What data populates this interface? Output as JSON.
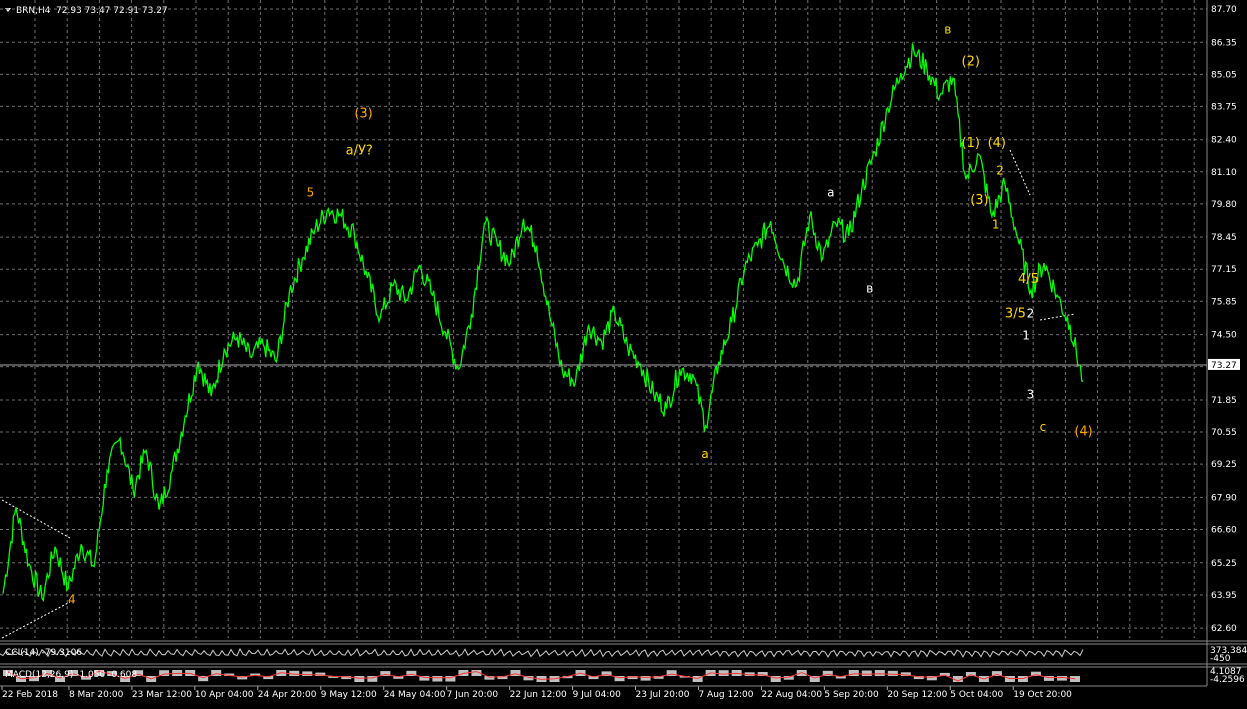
{
  "header": {
    "symbol": "BRN,H4",
    "ohlc": "72.93 73.47 72.91 73.27"
  },
  "current_price_label": "73.27",
  "colors": {
    "background": "#000000",
    "grid": "#6f6f6f",
    "price_line": "#00ff00",
    "wave_label_orange": "#ffa500",
    "wave_label_yellow": "#ffd700",
    "wave_label_white": "#ffffff"
  },
  "indicators": {
    "cci": {
      "label": "CCI(14) -79.3106",
      "scale_top": "373.3845",
      "scale_bottom": "-450"
    },
    "macd": {
      "label": "MACD(12,26,9) -1.050 -0.608",
      "scale_top": "4.1087",
      "scale_bottom": "-4.2596"
    }
  },
  "chart_data": {
    "type": "line",
    "title": "",
    "xlabel": "",
    "ylabel": "",
    "ylim": [
      62.2,
      87.7
    ],
    "grid": true,
    "y_ticks": [
      "87.70",
      "86.35",
      "85.05",
      "83.75",
      "82.40",
      "81.10",
      "79.80",
      "78.45",
      "77.15",
      "75.85",
      "74.50",
      "73.20",
      "71.85",
      "70.55",
      "69.25",
      "67.90",
      "66.60",
      "65.25",
      "63.95",
      "62.60"
    ],
    "x_ticks": [
      "22 Feb 2018",
      "8 Mar 20:00",
      "23 Mar 12:00",
      "10 Apr 04:00",
      "24 Apr 20:00",
      "9 May 12:00",
      "24 May 04:00",
      "7 Jun 20:00",
      "22 Jun 12:00",
      "9 Jul 04:00",
      "23 Jul 20:00",
      "7 Aug 12:00",
      "22 Aug 04:00",
      "5 Sep 20:00",
      "20 Sep 12:00",
      "5 Oct 04:00",
      "19 Oct 20:00"
    ],
    "x_range": [
      "22 Feb 2018",
      "29 Oct 2018"
    ],
    "series": [
      {
        "dates": [
          "22 Feb",
          "25 Feb",
          "28 Feb",
          "3 Mar",
          "6 Mar",
          "9 Mar",
          "12 Mar",
          "15 Mar",
          "18 Mar",
          "21 Mar",
          "24 Mar",
          "27 Mar",
          "30 Mar",
          "2 Apr",
          "5 Apr",
          "8 Apr",
          "11 Apr",
          "14 Apr",
          "17 Apr",
          "20 Apr",
          "23 Apr",
          "26 Apr",
          "29 Apr",
          "2 May",
          "5 May",
          "8 May",
          "11 May",
          "14 May",
          "17 May",
          "20 May",
          "23 May",
          "26 May",
          "29 May",
          "1 Jun",
          "4 Jun",
          "7 Jun",
          "10 Jun",
          "13 Jun",
          "16 Jun",
          "19 Jun",
          "22 Jun",
          "25 Jun",
          "28 Jun",
          "1 Jul",
          "4 Jul",
          "7 Jul",
          "10 Jul",
          "13 Jul",
          "16 Jul",
          "19 Jul",
          "22 Jul",
          "25 Jul",
          "28 Jul",
          "31 Jul",
          "3 Aug",
          "6 Aug",
          "9 Aug",
          "12 Aug",
          "15 Aug",
          "18 Aug",
          "21 Aug",
          "24 Aug",
          "27 Aug",
          "30 Aug",
          "2 Sep",
          "5 Sep",
          "8 Sep",
          "11 Sep",
          "14 Sep",
          "17 Sep",
          "20 Sep",
          "23 Sep",
          "26 Sep",
          "29 Sep",
          "2 Oct",
          "5 Oct",
          "8 Oct",
          "11 Oct",
          "14 Oct",
          "17 Oct",
          "20 Oct",
          "23 Oct",
          "26 Oct",
          "29 Oct"
        ],
        "values": [
          64.0,
          67.5,
          65.2,
          63.8,
          65.9,
          64.2,
          66.0,
          65.1,
          69.0,
          70.3,
          68.2,
          69.8,
          67.4,
          69.0,
          71.2,
          73.4,
          72.0,
          73.9,
          74.4,
          73.6,
          74.1,
          73.4,
          76.2,
          77.6,
          78.8,
          79.6,
          79.3,
          78.6,
          76.8,
          75.2,
          76.5,
          75.9,
          77.3,
          76.1,
          74.6,
          73.1,
          75.3,
          79.0,
          78.1,
          77.4,
          79.2,
          78.1,
          75.3,
          73.0,
          72.6,
          74.9,
          74.2,
          75.4,
          74.0,
          73.3,
          72.1,
          71.5,
          73.1,
          72.9,
          70.8,
          73.4,
          75.0,
          77.2,
          78.1,
          79.1,
          77.4,
          76.5,
          79.3,
          77.6,
          79.0,
          78.5,
          80.4,
          81.9,
          83.7,
          85.1,
          86.0,
          85.3,
          84.2,
          84.9,
          80.8,
          81.8,
          79.3,
          80.6,
          78.4,
          76.3,
          77.4,
          76.1,
          74.9,
          72.6
        ]
      }
    ],
    "current_price": 73.27,
    "annotations": [
      {
        "text": "(3)",
        "color": "orange",
        "x": "14 May",
        "y": 83.3
      },
      {
        "text": "a/У?",
        "color": "yellow",
        "x": "12 May",
        "y": 81.8
      },
      {
        "text": "5",
        "color": "orange",
        "x": "3 May",
        "y": 80.1
      },
      {
        "text": "4",
        "color": "orange",
        "x": "9 Mar",
        "y": 63.6
      },
      {
        "text": "a",
        "color": "yellow",
        "x": "2 Aug",
        "y": 69.5
      },
      {
        "text": "a",
        "color": "white",
        "x": "31 Aug",
        "y": 80.1
      },
      {
        "text": "в",
        "color": "white",
        "x": "9 Sep",
        "y": 76.2
      },
      {
        "text": "в",
        "color": "yellow",
        "x": "27 Sep",
        "y": 86.7
      },
      {
        "text": "(2)",
        "color": "yellow",
        "x": "1 Oct",
        "y": 85.4
      },
      {
        "text": "(1)",
        "color": "yellow",
        "x": "1 Oct",
        "y": 82.1
      },
      {
        "text": "(4)",
        "color": "yellow",
        "x": "7 Oct",
        "y": 82.1
      },
      {
        "text": "(3)",
        "color": "yellow",
        "x": "3 Oct",
        "y": 79.8
      },
      {
        "text": "2",
        "color": "yellow",
        "x": "9 Oct",
        "y": 81.0
      },
      {
        "text": "1",
        "color": "yellow",
        "x": "8 Oct",
        "y": 78.8
      },
      {
        "text": "4/5",
        "color": "yellow",
        "x": "14 Oct",
        "y": 76.6
      },
      {
        "text": "3/5",
        "color": "yellow",
        "x": "11 Oct",
        "y": 75.2
      },
      {
        "text": "2",
        "color": "white",
        "x": "16 Oct",
        "y": 75.2
      },
      {
        "text": "1",
        "color": "white",
        "x": "15 Oct",
        "y": 74.3
      },
      {
        "text": "3",
        "color": "white",
        "x": "16 Oct",
        "y": 71.9
      },
      {
        "text": "c",
        "color": "yellow",
        "x": "19 Oct",
        "y": 70.6
      },
      {
        "text": "(4)",
        "color": "orange",
        "x": "27 Oct",
        "y": 70.4
      }
    ]
  }
}
